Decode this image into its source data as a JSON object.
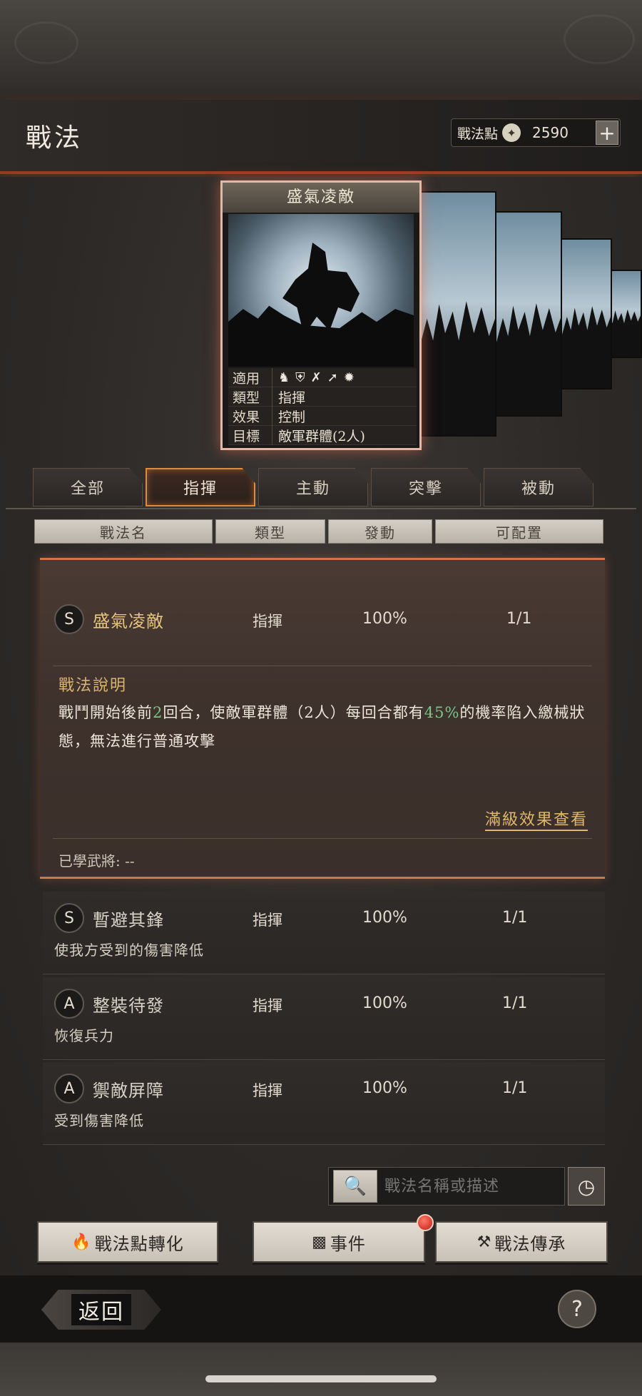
{
  "header": {
    "title": "戰法",
    "points_label": "戰法點",
    "points_value": "2590",
    "plus_label": "+"
  },
  "card": {
    "name": "盛氣凌敵",
    "rows": [
      {
        "key": "適用",
        "value": ""
      },
      {
        "key": "類型",
        "value": "指揮"
      },
      {
        "key": "效果",
        "value": "控制"
      },
      {
        "key": "目標",
        "value": "敵軍群體(2人)"
      }
    ],
    "applicable_icons": [
      "cavalry-icon",
      "shield-icon",
      "bow-icon",
      "spear-icon",
      "wheel-icon"
    ]
  },
  "tabs": [
    "全部",
    "指揮",
    "主動",
    "突擊",
    "被動"
  ],
  "active_tab": "指揮",
  "columns": [
    "戰法名",
    "類型",
    "發動",
    "可配置"
  ],
  "expanded_item": {
    "grade": "S",
    "name": "盛氣凌敵",
    "type": "指揮",
    "rate": "100%",
    "slots": "1/1",
    "desc_title": "戰法說明",
    "desc_part1": "戰鬥開始後前",
    "desc_num1": "2",
    "desc_part2": "回合，使敵軍群體（2人）每回合都有",
    "desc_num2": "45%",
    "desc_part3": "的機率陷入繳械狀態，無法進行普通攻擊",
    "detail_link": "滿級效果查看",
    "learned": "已學武將: --"
  },
  "items": [
    {
      "grade": "S",
      "name": "暫避其鋒",
      "type": "指揮",
      "rate": "100%",
      "slots": "1/1",
      "desc": "使我方受到的傷害降低"
    },
    {
      "grade": "A",
      "name": "整裝待發",
      "type": "指揮",
      "rate": "100%",
      "slots": "1/1",
      "desc": "恢復兵力"
    },
    {
      "grade": "A",
      "name": "禦敵屏障",
      "type": "指揮",
      "rate": "100%",
      "slots": "1/1",
      "desc": "受到傷害降低"
    }
  ],
  "search": {
    "placeholder": "戰法名稱或描述"
  },
  "buttons": {
    "convert": "戰法點轉化",
    "events": "事件",
    "inherit": "戰法傳承"
  },
  "footer": {
    "back": "返回",
    "help": "?"
  },
  "colors": {
    "accent_orange": "#d2744a",
    "highlight_green": "#7bc48a",
    "gold_text": "#d9b46e"
  }
}
